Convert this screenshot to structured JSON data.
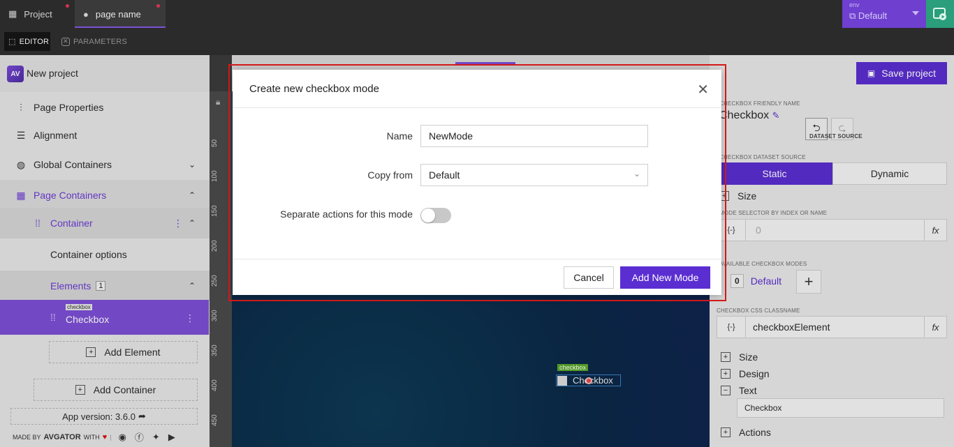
{
  "topbar": {
    "tabs": [
      {
        "label": "Project",
        "icon": "grid-icon"
      },
      {
        "label": "page name",
        "icon": "drop-icon"
      }
    ],
    "env_label": "env",
    "env_value": "Default"
  },
  "subbar": {
    "editor": "EDITOR",
    "parameters": "PARAMETERS"
  },
  "sidebar": {
    "project_name": "New project",
    "logo_text": "AV",
    "items": [
      {
        "label": "Page Properties",
        "icon": "sliders-icon"
      },
      {
        "label": "Alignment",
        "icon": "align-icon"
      },
      {
        "label": "Global Containers",
        "icon": "globe-icon"
      },
      {
        "label": "Page Containers",
        "icon": "layout-icon"
      },
      {
        "label": "Container",
        "icon": "drag-handle-icon"
      },
      {
        "label": "Container options"
      },
      {
        "label": "Elements",
        "badge": "1"
      }
    ],
    "selected_element": {
      "tag": "checkbox",
      "label": "Checkbox"
    },
    "add_element": "Add Element",
    "add_container": "Add Container",
    "app_version": "App version: 3.6.0",
    "made_by": "MADE BY",
    "brand": "AVGATOR",
    "with": "WITH"
  },
  "ruler": {
    "ticks": [
      "50",
      "100",
      "150",
      "200",
      "250",
      "300",
      "350",
      "400",
      "450"
    ]
  },
  "stage": {
    "element_tag": "checkbox",
    "element_label": "Checkbox"
  },
  "header": {
    "save": "Save project"
  },
  "rpanel": {
    "friendly_name_label": "CHECKBOX FRIENDLY NAME",
    "friendly_name": "Checkbox",
    "dataset_source": "DATASET SOURCE",
    "dataset_source_label": "CHECKBOX DATASET SOURCE",
    "static": "Static",
    "dynamic": "Dynamic",
    "size": "Size",
    "mode_selector_label": "MODE SELECTOR BY INDEX OR NAME",
    "mode_selector_value": "0",
    "available_modes_label": "AVAILABLE CHECKBOX MODES",
    "mode_index": "0",
    "mode_name": "Default",
    "css_label": "CHECKBOX CSS CLASSNAME",
    "css_value": "checkboxElement",
    "sections": [
      "Size",
      "Design",
      "Text"
    ],
    "text_value": "Checkbox",
    "actions": "Actions"
  },
  "modal": {
    "title": "Create new checkbox mode",
    "name_label": "Name",
    "name_value": "NewMode",
    "copy_label": "Copy from",
    "copy_value": "Default",
    "separate_label": "Separate actions for this mode",
    "cancel": "Cancel",
    "add": "Add New Mode"
  },
  "colors": {
    "accent": "#5b2ed1",
    "selected": "#7c4fd6",
    "highlight": "#d61a1a"
  }
}
